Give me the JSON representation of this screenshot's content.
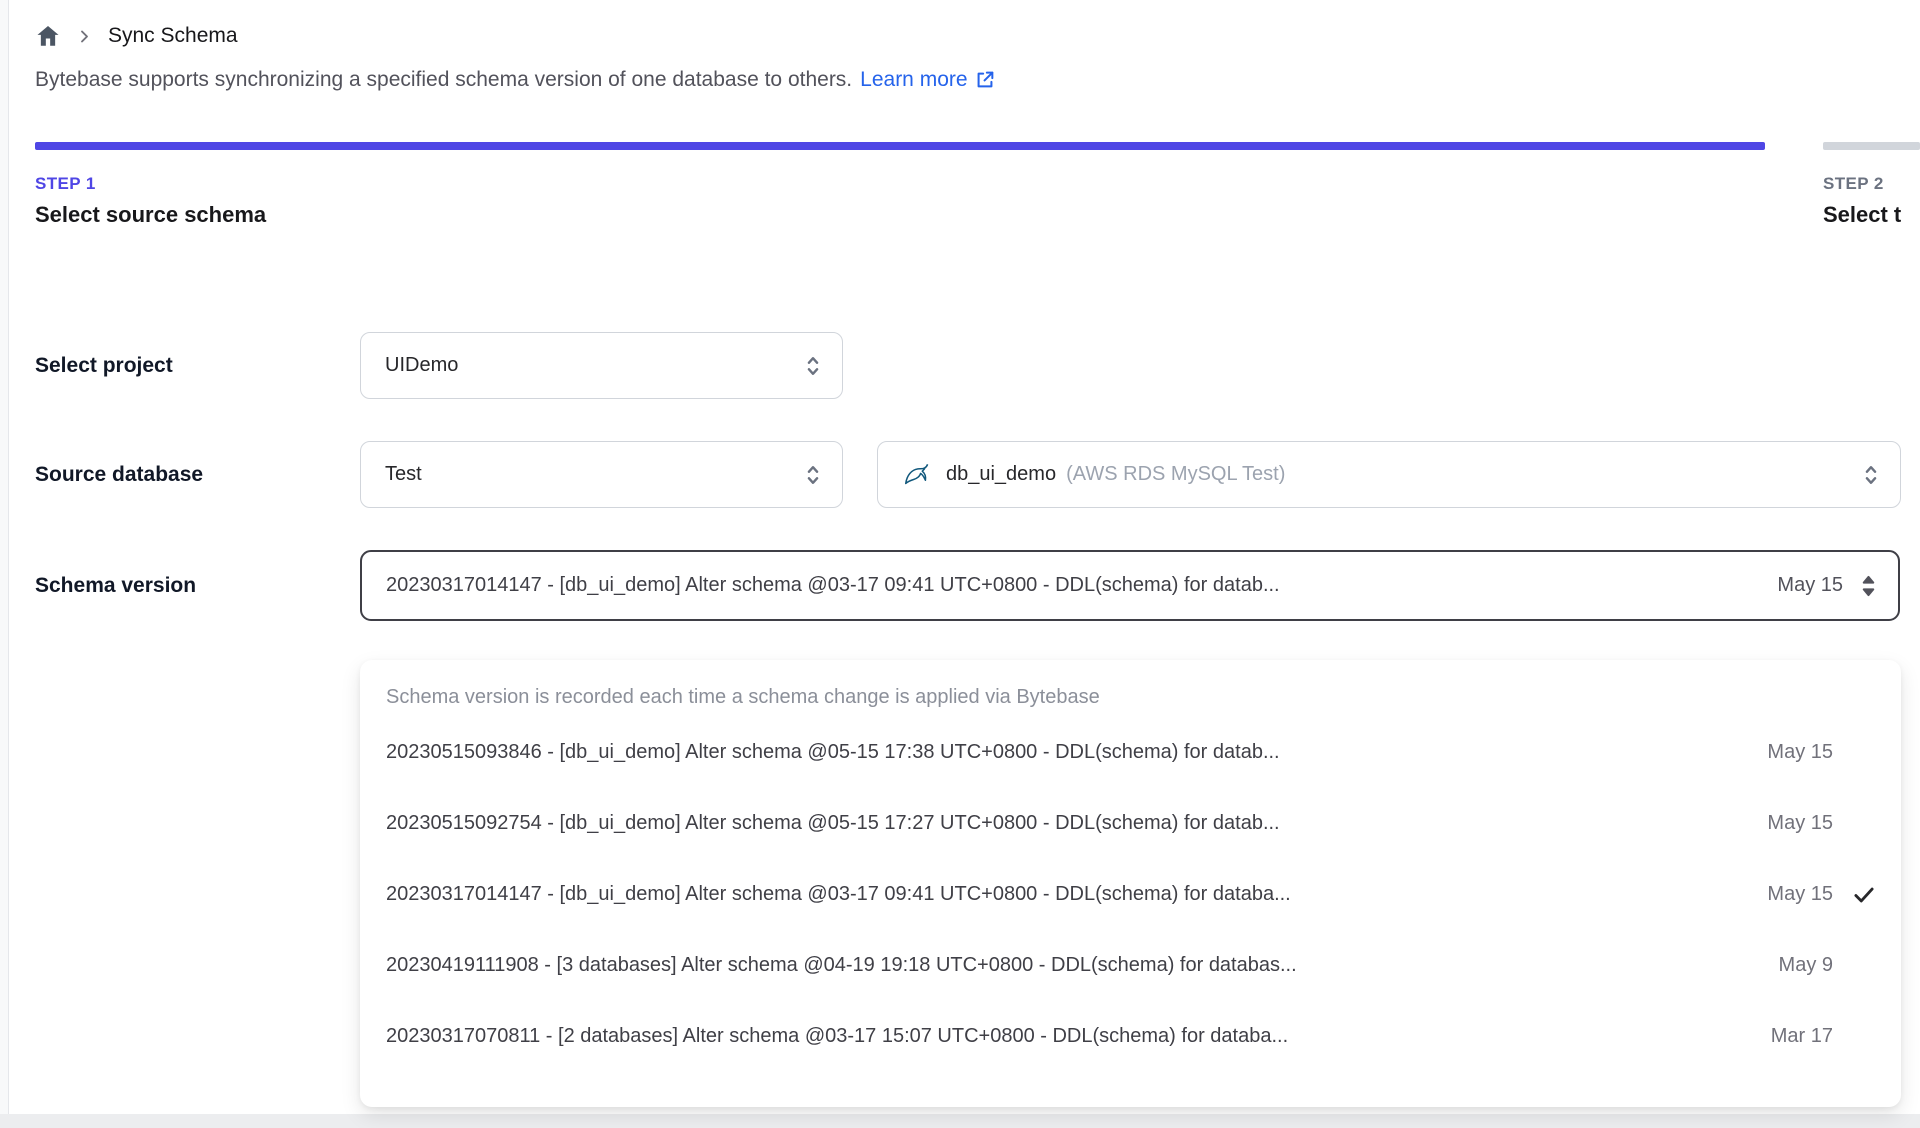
{
  "breadcrumb": {
    "title": "Sync Schema"
  },
  "intro": {
    "text": "Bytebase supports synchronizing a specified schema version of one database to others.",
    "link_label": "Learn more"
  },
  "steps": [
    {
      "step": "STEP 1",
      "title": "Select source schema",
      "active": true
    },
    {
      "step": "STEP 2",
      "title": "Select t",
      "active": false
    }
  ],
  "form": {
    "project": {
      "label": "Select project",
      "value": "UIDemo"
    },
    "source_database": {
      "label": "Source database",
      "environment": "Test",
      "database": "db_ui_demo",
      "database_detail": "(AWS RDS MySQL Test)"
    },
    "schema_version": {
      "label": "Schema version",
      "value": "20230317014147 - [db_ui_demo] Alter schema @03-17 09:41 UTC+0800 - DDL(schema) for datab...",
      "date": "May 15"
    }
  },
  "version_dropdown": {
    "header": "Schema version is recorded each time a schema change is applied via Bytebase",
    "options": [
      {
        "text": "20230515093846 - [db_ui_demo] Alter schema @05-15 17:38 UTC+0800 - DDL(schema) for datab...",
        "date": "May 15",
        "selected": false
      },
      {
        "text": "20230515092754 - [db_ui_demo] Alter schema @05-15 17:27 UTC+0800 - DDL(schema) for datab...",
        "date": "May 15",
        "selected": false
      },
      {
        "text": "20230317014147 - [db_ui_demo] Alter schema @03-17 09:41 UTC+0800 - DDL(schema) for databa...",
        "date": "May 15",
        "selected": true
      },
      {
        "text": "20230419111908 - [3 databases] Alter schema @04-19 19:18 UTC+0800 - DDL(schema) for databas...",
        "date": "May 9",
        "selected": false
      },
      {
        "text": "20230317070811 - [2 databases] Alter schema @03-17 15:07 UTC+0800 - DDL(schema) for databa...",
        "date": "Mar 17",
        "selected": false
      }
    ]
  },
  "icons": {
    "home": "house",
    "breadcrumb-separator": "chevron-right",
    "learn-more": "external-link",
    "select": "up-down-carets",
    "database-engine": "mysql-dolphin",
    "selected-option": "checkmark"
  },
  "colors": {
    "accent": "#4f46e5",
    "link": "#2563eb",
    "inactive_bar": "#d1d5db",
    "focus_border": "#3f3f46",
    "mysql_icon": "#11587c"
  }
}
